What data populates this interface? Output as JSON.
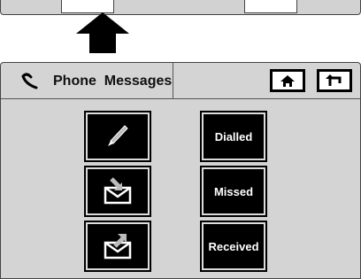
{
  "title": {
    "main": "Phone",
    "sub": "Messages"
  },
  "icons": {
    "handset": "phone-handset-icon",
    "home": "home-icon",
    "back": "back-arrow-icon",
    "compose": "pencil-icon",
    "inbox": "envelope-in-icon",
    "outbox": "envelope-out-icon",
    "pointer": "up-arrow-icon"
  },
  "buttons": {
    "dialled": "Dialled",
    "missed": "Missed",
    "received": "Received"
  },
  "colors": {
    "screen": "#d4d4d4",
    "tile": "#000000",
    "tile_text": "#ffffff"
  }
}
